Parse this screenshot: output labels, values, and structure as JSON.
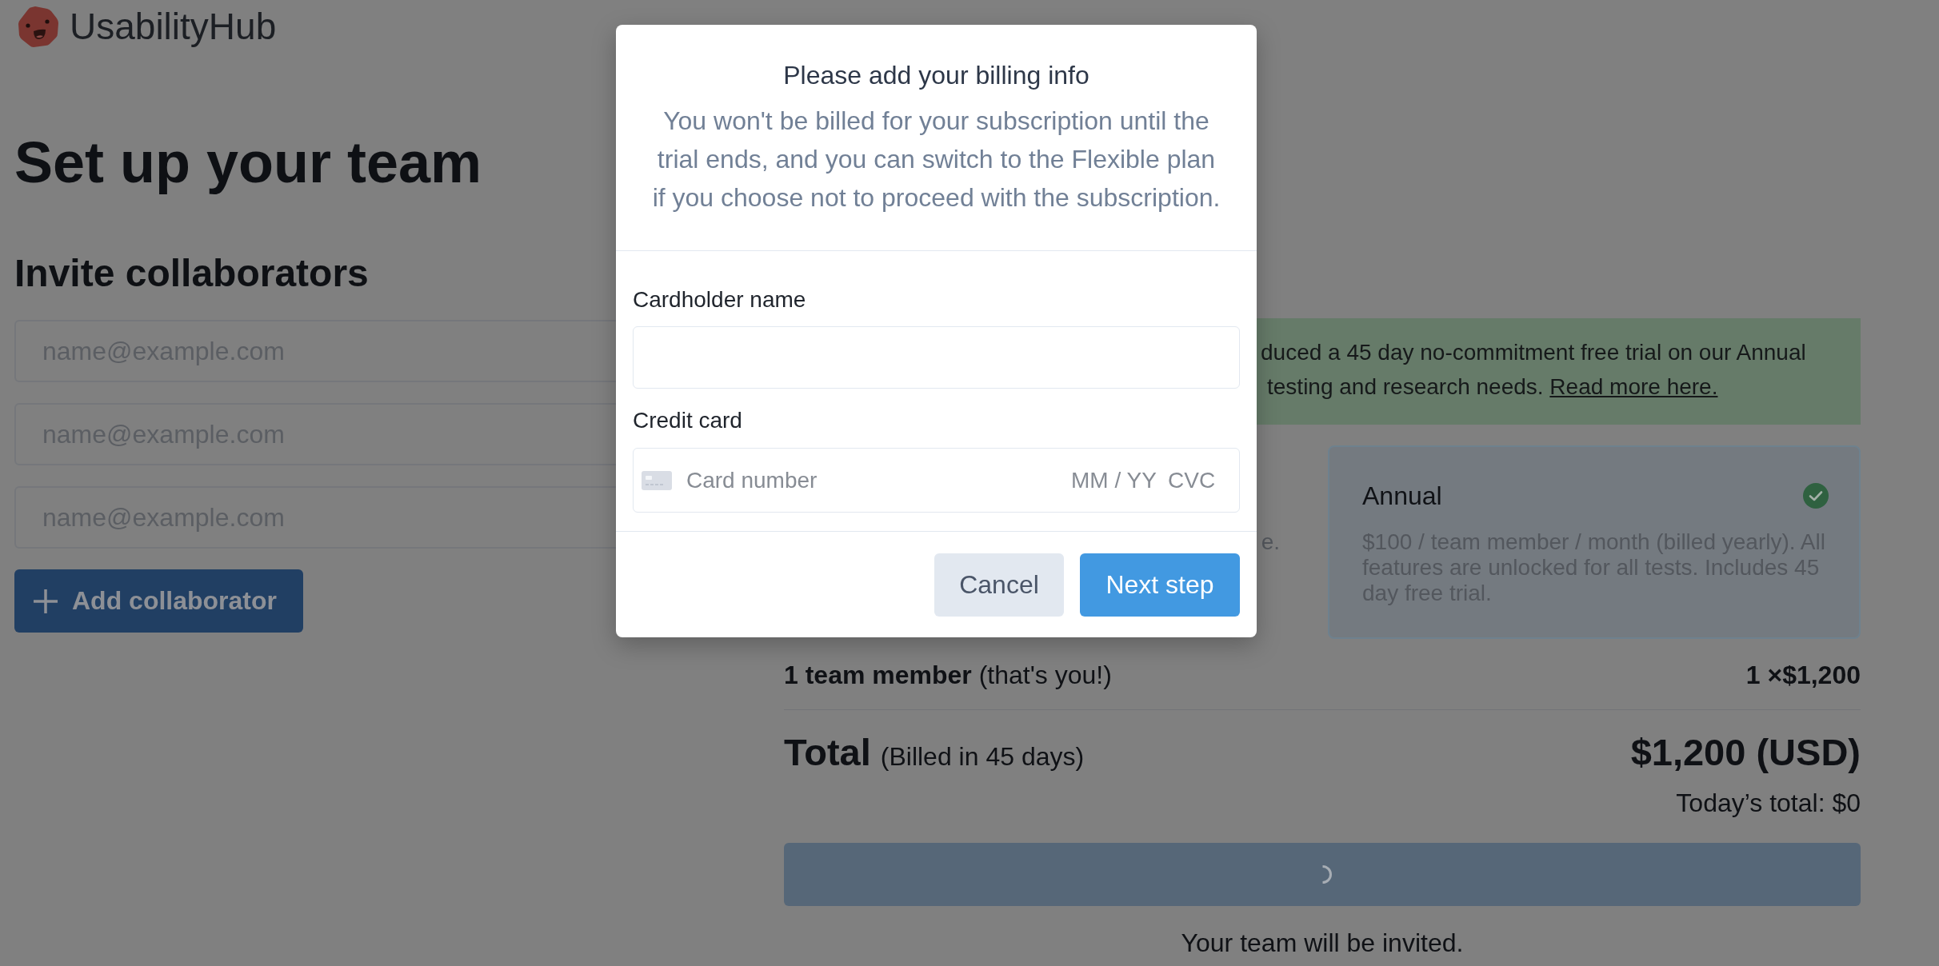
{
  "brand": {
    "name": "UsabilityHub"
  },
  "page": {
    "title": "Set up your team"
  },
  "invite": {
    "heading": "Invite collaborators",
    "fields": [
      {
        "placeholder": "name@example.com"
      },
      {
        "placeholder": "name@example.com"
      },
      {
        "placeholder": "name@example.com"
      }
    ],
    "add_button": "Add collaborator"
  },
  "plan_panel": {
    "banner": {
      "lines": [
        "duced a 45 day no-commitment free trial on our Annual",
        "testing and research needs."
      ],
      "link": "Read more here."
    },
    "plans": [
      {
        "description": "e.",
        "selected": false
      },
      {
        "name": "Annual",
        "description": "$100 / team member / month (billed yearly). All features are unlocked for all tests. Includes 45 day free trial.",
        "selected": true
      }
    ]
  },
  "summary": {
    "line_item": {
      "label": "**1 team member** (that's you!)",
      "amount": "1 ×$1,200"
    },
    "total": {
      "label": "Total",
      "note": "(Billed in 45 days)",
      "amount": "$1,200 (USD)"
    },
    "today_total": "Today’s total: $0",
    "submit": {
      "loading": true
    },
    "footnote": "Your team will be invited."
  },
  "modal": {
    "title": "Please add your billing info",
    "message": "You won't be billed for your subscription until the trial ends, and you can switch to the Flexible plan if you choose not to proceed with the subscription.",
    "fields": [
      {
        "kind": "text",
        "label": "Cardholder name"
      },
      {
        "kind": "card",
        "label": "Credit card",
        "placeholder": "Card number",
        "expiry_placeholder": "MM / YY",
        "cvc_placeholder": "CVC"
      }
    ],
    "buttons": [
      {
        "kind": "secondary",
        "label": "Cancel"
      },
      {
        "kind": "primary",
        "label": "Next step"
      }
    ]
  }
}
